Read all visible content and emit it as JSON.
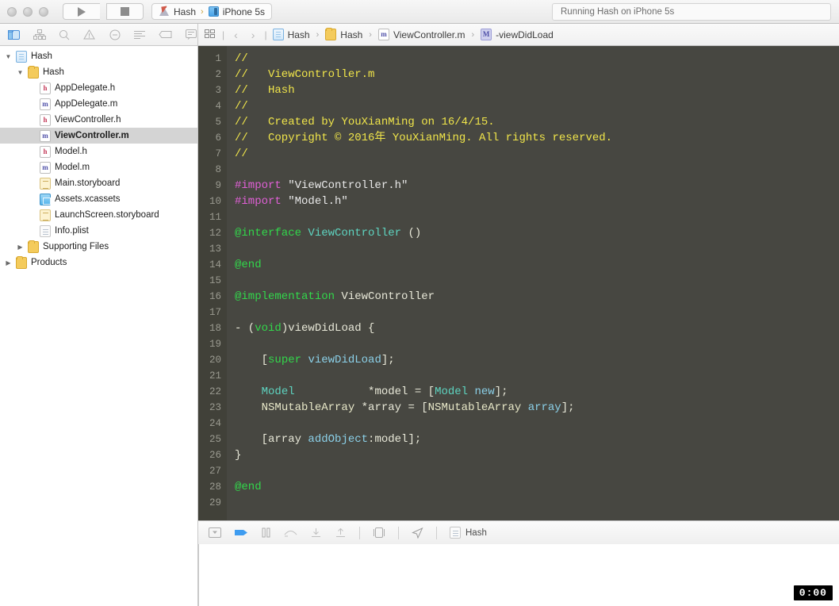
{
  "window": {
    "status_text": "Running Hash on iPhone 5s",
    "traffic_lights": [
      "close-button",
      "minimize-button",
      "zoom-button"
    ]
  },
  "toolbar": {
    "run_label": "run-button",
    "stop_label": "stop-button",
    "scheme_name": "Hash",
    "destination_name": "iPhone 5s",
    "scheme_separator": "›"
  },
  "navigator_toolbar": {
    "icons": [
      "project-navigator-icon",
      "symbol-navigator-icon",
      "find-navigator-icon",
      "issue-navigator-icon",
      "test-navigator-icon",
      "debug-navigator-icon",
      "breakpoint-navigator-icon",
      "report-navigator-icon"
    ]
  },
  "jumpbar": {
    "back_glyph": "‹",
    "forward_glyph": "›",
    "separator": "›",
    "crumbs": [
      {
        "label": "Hash",
        "icon": "project-icon"
      },
      {
        "label": "Hash",
        "icon": "folder-icon"
      },
      {
        "label": "ViewController.m",
        "icon": "objc-m-icon"
      },
      {
        "label": "-viewDidLoad",
        "icon": "method-icon"
      }
    ]
  },
  "navigator": {
    "items": [
      {
        "label": "Hash",
        "indent": 0,
        "disclosure": "open",
        "icon": "project-icon",
        "selected": false
      },
      {
        "label": "Hash",
        "indent": 1,
        "disclosure": "open",
        "icon": "folder-icon",
        "selected": false
      },
      {
        "label": "AppDelegate.h",
        "indent": 2,
        "disclosure": "none",
        "icon": "header-file-icon",
        "selected": false
      },
      {
        "label": "AppDelegate.m",
        "indent": 2,
        "disclosure": "none",
        "icon": "objc-file-icon",
        "selected": false
      },
      {
        "label": "ViewController.h",
        "indent": 2,
        "disclosure": "none",
        "icon": "header-file-icon",
        "selected": false
      },
      {
        "label": "ViewController.m",
        "indent": 2,
        "disclosure": "none",
        "icon": "objc-file-icon",
        "selected": true
      },
      {
        "label": "Model.h",
        "indent": 2,
        "disclosure": "none",
        "icon": "header-file-icon",
        "selected": false
      },
      {
        "label": "Model.m",
        "indent": 2,
        "disclosure": "none",
        "icon": "objc-file-icon",
        "selected": false
      },
      {
        "label": "Main.storyboard",
        "indent": 2,
        "disclosure": "none",
        "icon": "storyboard-icon",
        "selected": false
      },
      {
        "label": "Assets.xcassets",
        "indent": 2,
        "disclosure": "none",
        "icon": "assets-icon",
        "selected": false
      },
      {
        "label": "LaunchScreen.storyboard",
        "indent": 2,
        "disclosure": "none",
        "icon": "storyboard-icon",
        "selected": false
      },
      {
        "label": "Info.plist",
        "indent": 2,
        "disclosure": "none",
        "icon": "plist-icon",
        "selected": false
      },
      {
        "label": "Supporting Files",
        "indent": 1,
        "disclosure": "closed",
        "icon": "folder-icon",
        "selected": false
      },
      {
        "label": "Products",
        "indent": 0,
        "disclosure": "closed",
        "icon": "folder-icon",
        "selected": false
      }
    ]
  },
  "editor": {
    "line_numbers": [
      1,
      2,
      3,
      4,
      5,
      6,
      7,
      8,
      9,
      10,
      11,
      12,
      13,
      14,
      15,
      16,
      17,
      18,
      19,
      20,
      21,
      22,
      23,
      24,
      25,
      26,
      27,
      28,
      29
    ],
    "lines": [
      {
        "n": 1,
        "tokens": [
          {
            "t": "//",
            "c": "c-com"
          }
        ]
      },
      {
        "n": 2,
        "tokens": [
          {
            "t": "//   ViewController.m",
            "c": "c-com"
          }
        ]
      },
      {
        "n": 3,
        "tokens": [
          {
            "t": "//   Hash",
            "c": "c-com"
          }
        ]
      },
      {
        "n": 4,
        "tokens": [
          {
            "t": "//",
            "c": "c-com"
          }
        ]
      },
      {
        "n": 5,
        "tokens": [
          {
            "t": "//   Created by YouXianMing on 16/4/15.",
            "c": "c-com"
          }
        ]
      },
      {
        "n": 6,
        "tokens": [
          {
            "t": "//   Copyright © 2016年 YouXianMing. All rights reserved.",
            "c": "c-com"
          }
        ]
      },
      {
        "n": 7,
        "tokens": [
          {
            "t": "//",
            "c": "c-com"
          }
        ]
      },
      {
        "n": 8,
        "tokens": []
      },
      {
        "n": 9,
        "tokens": [
          {
            "t": "#import",
            "c": "c-pre"
          },
          {
            "t": " ",
            "c": "c-plain"
          },
          {
            "t": "\"ViewController.h\"",
            "c": "c-str"
          }
        ]
      },
      {
        "n": 10,
        "tokens": [
          {
            "t": "#import",
            "c": "c-pre"
          },
          {
            "t": " ",
            "c": "c-plain"
          },
          {
            "t": "\"Model.h\"",
            "c": "c-str"
          }
        ]
      },
      {
        "n": 11,
        "tokens": []
      },
      {
        "n": 12,
        "tokens": [
          {
            "t": "@interface",
            "c": "c-kw"
          },
          {
            "t": " ",
            "c": "c-plain"
          },
          {
            "t": "ViewController",
            "c": "c-type"
          },
          {
            "t": " ()",
            "c": "c-plain"
          }
        ]
      },
      {
        "n": 13,
        "tokens": []
      },
      {
        "n": 14,
        "tokens": [
          {
            "t": "@end",
            "c": "c-kw"
          }
        ]
      },
      {
        "n": 15,
        "tokens": []
      },
      {
        "n": 16,
        "tokens": [
          {
            "t": "@implementation",
            "c": "c-kw"
          },
          {
            "t": " ViewController",
            "c": "c-plain"
          }
        ]
      },
      {
        "n": 17,
        "tokens": []
      },
      {
        "n": 18,
        "tokens": [
          {
            "t": "- (",
            "c": "c-plain"
          },
          {
            "t": "void",
            "c": "c-kw"
          },
          {
            "t": ")viewDidLoad {",
            "c": "c-plain"
          }
        ]
      },
      {
        "n": 19,
        "tokens": []
      },
      {
        "n": 20,
        "tokens": [
          {
            "t": "    [",
            "c": "c-plain"
          },
          {
            "t": "super",
            "c": "c-kw"
          },
          {
            "t": " ",
            "c": "c-plain"
          },
          {
            "t": "viewDidLoad",
            "c": "c-meth"
          },
          {
            "t": "];",
            "c": "c-plain"
          }
        ]
      },
      {
        "n": 21,
        "tokens": []
      },
      {
        "n": 22,
        "tokens": [
          {
            "t": "    ",
            "c": "c-plain"
          },
          {
            "t": "Model",
            "c": "c-type"
          },
          {
            "t": "           *model = [",
            "c": "c-plain"
          },
          {
            "t": "Model",
            "c": "c-type"
          },
          {
            "t": " ",
            "c": "c-plain"
          },
          {
            "t": "new",
            "c": "c-meth"
          },
          {
            "t": "];",
            "c": "c-plain"
          }
        ]
      },
      {
        "n": 23,
        "tokens": [
          {
            "t": "    ",
            "c": "c-plain"
          },
          {
            "t": "NSMutableArray",
            "c": "c-sys"
          },
          {
            "t": " *array = [",
            "c": "c-plain"
          },
          {
            "t": "NSMutableArray",
            "c": "c-sys"
          },
          {
            "t": " ",
            "c": "c-plain"
          },
          {
            "t": "array",
            "c": "c-meth"
          },
          {
            "t": "];",
            "c": "c-plain"
          }
        ]
      },
      {
        "n": 24,
        "tokens": []
      },
      {
        "n": 25,
        "tokens": [
          {
            "t": "    [array ",
            "c": "c-plain"
          },
          {
            "t": "addObject",
            "c": "c-meth"
          },
          {
            "t": ":model];",
            "c": "c-plain"
          }
        ]
      },
      {
        "n": 26,
        "tokens": [
          {
            "t": "}",
            "c": "c-plain"
          }
        ]
      },
      {
        "n": 27,
        "tokens": []
      },
      {
        "n": 28,
        "tokens": [
          {
            "t": "@end",
            "c": "c-kw"
          }
        ]
      },
      {
        "n": 29,
        "tokens": []
      }
    ],
    "background_color": "#474741",
    "gutter_color": "#414139",
    "comment_color": "#f0e54a",
    "preprocessor_color": "#e060d6",
    "keyword_color": "#32d74b",
    "type_color": "#5ed4c0",
    "method_color": "#8bd0e8"
  },
  "debugbar": {
    "icons": [
      "hide-debug-area-icon",
      "debug-view-hierarchy-icon",
      "pause-icon",
      "step-over-icon",
      "step-into-icon",
      "step-out-icon",
      "debug-view-icon",
      "simulate-location-icon"
    ],
    "process_icon": "process-icon",
    "process_label": "Hash"
  },
  "overlay": {
    "timer_label": "0:00"
  }
}
